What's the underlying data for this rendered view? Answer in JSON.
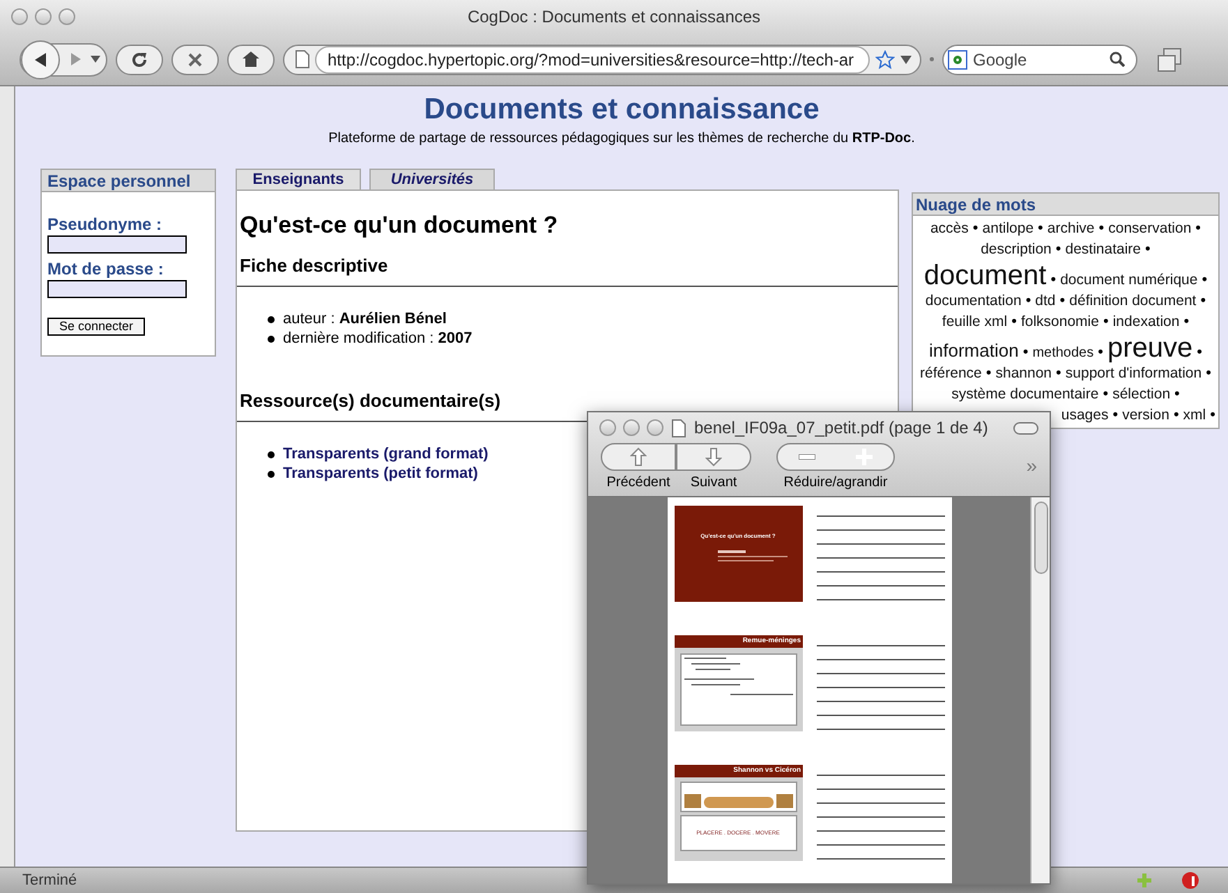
{
  "window": {
    "title": "CogDoc : Documents et connaissances"
  },
  "toolbar": {
    "url": "http://cogdoc.hypertopic.org/?mod=universities&resource=http://tech-ar",
    "search": {
      "placeholder": "Google"
    }
  },
  "header": {
    "title": "Documents et connaissance",
    "subtitle": "Plateforme de partage de ressources pédagogiques sur les thèmes de recherche du **RTP-Doc**."
  },
  "login": {
    "title": "Espace personnel",
    "fields": [
      {
        "label": "Pseudonyme :"
      },
      {
        "label": "Mot de passe :"
      }
    ],
    "button": "Se connecter"
  },
  "tabs": [
    {
      "label": "Enseignants",
      "selected": false
    },
    {
      "label": "Universités",
      "selected": true
    }
  ],
  "document": {
    "title": "Qu'est-ce qu'un document ?",
    "sections": [
      {
        "heading": "Fiche descriptive",
        "items": [
          {
            "kind": "field",
            "label": "auteur : ",
            "value": "Aurélien Bénel"
          },
          {
            "kind": "field",
            "label": "dernière modification : ",
            "value": "2007"
          }
        ]
      },
      {
        "heading": "Ressource(s) documentaire(s)",
        "items": [
          {
            "kind": "link",
            "value": "Transparents (grand format)"
          },
          {
            "kind": "link",
            "value": "Transparents (petit format)"
          }
        ]
      }
    ]
  },
  "tag_cloud": {
    "title": "Nuage de mots",
    "separator": "•",
    "lines": [
      [
        {
          "text": "accès",
          "kind": "normal"
        },
        {
          "text": "antilope",
          "kind": "normal"
        },
        {
          "text": "archive",
          "kind": "normal"
        },
        {
          "text": "conservation",
          "kind": "normal"
        }
      ],
      [
        {
          "text": "description",
          "kind": "normal"
        },
        {
          "text": "destinataire",
          "kind": "normal"
        }
      ],
      [
        {
          "text": "document",
          "kind": "huge"
        },
        {
          "text": "document numérique",
          "kind": "normal"
        }
      ],
      [
        {
          "text": "documentation",
          "kind": "normal"
        },
        {
          "text": "dtd",
          "kind": "normal"
        },
        {
          "text": "définition document",
          "kind": "normal"
        }
      ],
      [
        {
          "text": "feuille xml",
          "kind": "normal"
        },
        {
          "text": "folksonomie",
          "kind": "normal"
        },
        {
          "text": "indexation",
          "kind": "normal"
        }
      ],
      [
        {
          "text": "information",
          "kind": "large"
        },
        {
          "text": "methodes",
          "kind": "small"
        },
        {
          "text": "preuve",
          "kind": "huge"
        }
      ],
      [
        {
          "text": "référence",
          "kind": "normal"
        },
        {
          "text": "shannon",
          "kind": "normal"
        },
        {
          "text": "support d'information",
          "kind": "normal"
        }
      ],
      [
        {
          "text": "système documentaire",
          "kind": "normal"
        },
        {
          "text": "sélection",
          "kind": "normal"
        }
      ],
      [
        {
          "text": "usages",
          "kind": "normal"
        },
        {
          "text": "version",
          "kind": "normal"
        },
        {
          "text": "xml",
          "kind": "normal"
        }
      ]
    ]
  },
  "pdf_viewer": {
    "title": "benel_IF09a_07_petit.pdf (page 1 de 4)",
    "buttons": [
      {
        "label": "Précédent"
      },
      {
        "label": "Suivant"
      },
      {
        "label": "Réduire/agrandir"
      }
    ],
    "more": "»",
    "slides": [
      {
        "kind": "title",
        "title": "Qu'est-ce qu'un document ?"
      },
      {
        "kind": "bullets",
        "title": "Remue-méninges"
      },
      {
        "kind": "diagram",
        "title": "Shannon vs Cicéron",
        "footer": "PLACERE . DOCERE . MOVERE"
      }
    ]
  },
  "status_bar": {
    "text": "Terminé"
  }
}
